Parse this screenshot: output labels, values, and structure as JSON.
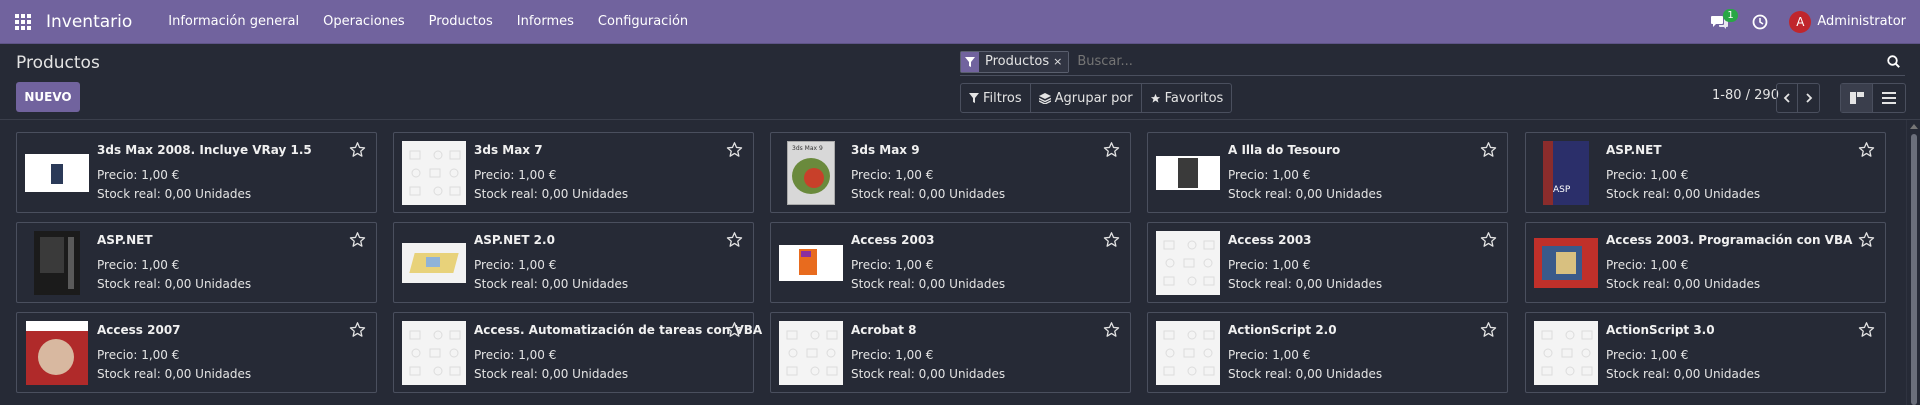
{
  "navbar": {
    "brand": "Inventario",
    "menu": [
      "Información general",
      "Operaciones",
      "Productos",
      "Informes",
      "Configuración"
    ],
    "chat_count": "1",
    "user_initial": "A",
    "user_name": "Administrator",
    "colors": {
      "navbar": "#71639e",
      "badge": "#28a745",
      "avatar": "#c0262d"
    }
  },
  "control_panel": {
    "title": "Productos",
    "new_button": "NUEVO",
    "search": {
      "facet": "Productos",
      "facet_close": "×",
      "placeholder": "Buscar..."
    },
    "filters": [
      "Filtros",
      "Agrupar por",
      "Favoritos"
    ],
    "pager": "1-80 / 290"
  },
  "products": [
    {
      "name": "3ds Max 2008. Incluye VRay 1.5",
      "price": "Precio: 1,00 €",
      "stock": "Stock real: 0,00 Unidades",
      "image": "book-cover-wide"
    },
    {
      "name": "3ds Max 7",
      "price": "Precio: 1,00 €",
      "stock": "Stock real: 0,00 Unidades",
      "image": "placeholder"
    },
    {
      "name": "3ds Max 9",
      "price": "Precio: 1,00 €",
      "stock": "Stock real: 0,00 Unidades",
      "image": "book-cover-3dsmax9"
    },
    {
      "name": "A Illa do Tesouro",
      "price": "Precio: 1,00 €",
      "stock": "Stock real: 0,00 Unidades",
      "image": "book-cover-small"
    },
    {
      "name": "ASP.NET",
      "price": "Precio: 1,00 €",
      "stock": "Stock real: 0,00 Unidades",
      "image": "book-cover-aspnet"
    },
    {
      "name": "ASP.NET",
      "price": "Precio: 1,00 €",
      "stock": "Stock real: 0,00 Unidades",
      "image": "book-cover-dark"
    },
    {
      "name": "ASP.NET 2.0",
      "price": "Precio: 1,00 €",
      "stock": "Stock real: 0,00 Unidades",
      "image": "book-cover-sketch"
    },
    {
      "name": "Access 2003",
      "price": "Precio: 1,00 €",
      "stock": "Stock real: 0,00 Unidades",
      "image": "book-cover-orange"
    },
    {
      "name": "Access 2003",
      "price": "Precio: 1,00 €",
      "stock": "Stock real: 0,00 Unidades",
      "image": "placeholder"
    },
    {
      "name": "Access 2003. Programación con VBA",
      "price": "Precio: 1,00 €",
      "stock": "Stock real: 0,00 Unidades",
      "image": "book-cover-vba"
    },
    {
      "name": "Access 2007",
      "price": "Precio: 1,00 €",
      "stock": "Stock real: 0,00 Unidades",
      "image": "book-cover-red"
    },
    {
      "name": "Access. Automatización de tareas con VBA",
      "price": "Precio: 1,00 €",
      "stock": "Stock real: 0,00 Unidades",
      "image": "placeholder"
    },
    {
      "name": "Acrobat 8",
      "price": "Precio: 1,00 €",
      "stock": "Stock real: 0,00 Unidades",
      "image": "placeholder"
    },
    {
      "name": "ActionScript 2.0",
      "price": "Precio: 1,00 €",
      "stock": "Stock real: 0,00 Unidades",
      "image": "placeholder"
    },
    {
      "name": "ActionScript 3.0",
      "price": "Precio: 1,00 €",
      "stock": "Stock real: 0,00 Unidades",
      "image": "placeholder"
    }
  ]
}
